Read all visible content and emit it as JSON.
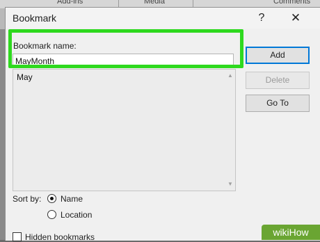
{
  "background": {
    "ribbon_tabs": [
      "Add-ins",
      "Media",
      "Comments"
    ]
  },
  "dialog": {
    "title": "Bookmark",
    "help_label": "?",
    "close_label": "✕",
    "bookmark_name_label": "Bookmark name:",
    "bookmark_name_value": "MayMonth",
    "bookmarks": [
      "May"
    ],
    "buttons": {
      "add": "Add",
      "delete": "Delete",
      "go_to": "Go To"
    },
    "sort_by_label": "Sort by:",
    "sort_options": [
      {
        "label": "Name",
        "selected": true
      },
      {
        "label": "Location",
        "selected": false
      }
    ],
    "hidden_bookmarks_label": "Hidden bookmarks",
    "hidden_bookmarks_checked": false
  },
  "watermark": "wikiHow",
  "colors": {
    "highlight": "#2ed91e",
    "primary_button_border": "#0078d7",
    "watermark_bg": "#6aa532"
  }
}
